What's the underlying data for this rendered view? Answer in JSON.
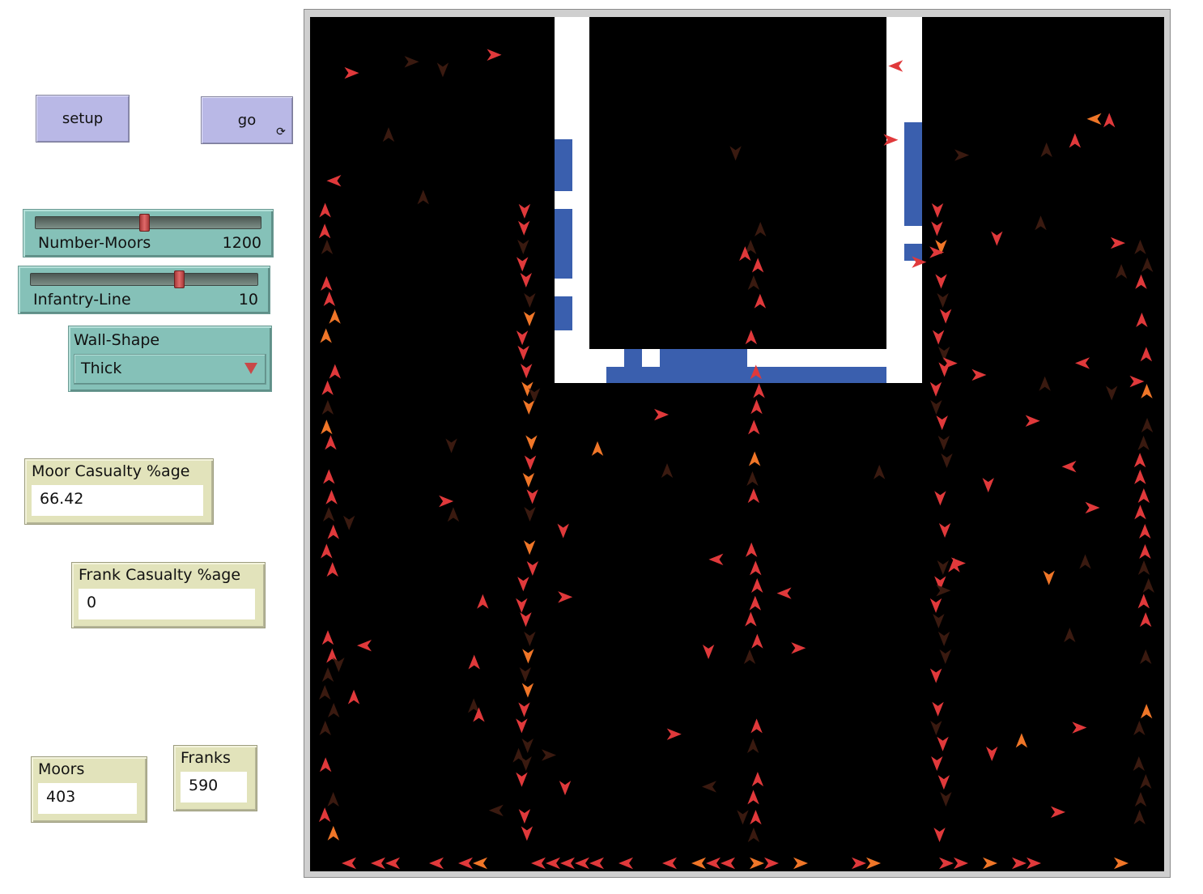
{
  "buttons": {
    "setup_label": "setup",
    "go_label": "go",
    "go_icon": "forever-arrows-icon"
  },
  "sliders": [
    {
      "name": "Number-Moors",
      "value": "1200",
      "fraction": 0.48
    },
    {
      "name": "Infantry-Line",
      "value": "10",
      "fraction": 0.65
    }
  ],
  "chooser": {
    "name": "Wall-Shape",
    "selected": "Thick"
  },
  "monitors": {
    "moor_casualty": {
      "label": "Moor Casualty %age",
      "value": "66.42"
    },
    "frank_casualty": {
      "label": "Frank Casualty %age",
      "value": "0"
    },
    "moors": {
      "label": "Moors",
      "value": "403"
    },
    "franks": {
      "label": "Franks",
      "value": "590"
    }
  },
  "world": {
    "background": "#000000",
    "wall_color": "#ffffff",
    "gate_color": "#3a5fae",
    "agent_colors": [
      "#e0393b",
      "#f07628",
      "#3a1a10"
    ]
  }
}
